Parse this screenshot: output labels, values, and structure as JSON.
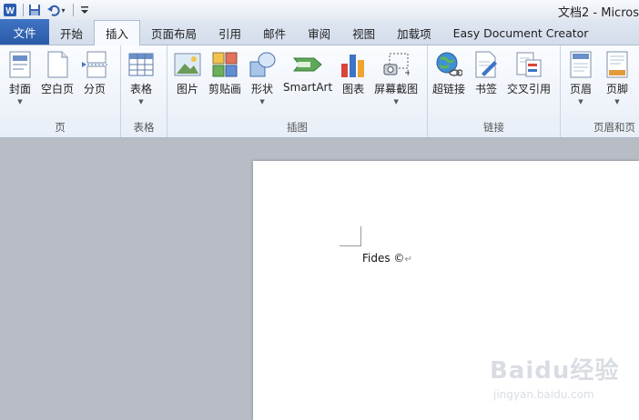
{
  "window": {
    "title": "文档2 - Micros"
  },
  "qat": {
    "undo_label": "↶",
    "more_label": "▾"
  },
  "tabs": [
    {
      "label": "文件"
    },
    {
      "label": "开始"
    },
    {
      "label": "插入"
    },
    {
      "label": "页面布局"
    },
    {
      "label": "引用"
    },
    {
      "label": "邮件"
    },
    {
      "label": "审阅"
    },
    {
      "label": "视图"
    },
    {
      "label": "加载项"
    },
    {
      "label": "Easy Document Creator"
    }
  ],
  "ribbon": {
    "groups": [
      {
        "label": "页",
        "buttons": [
          {
            "label": "封面",
            "icon": "cover-page-icon",
            "has_dropdown": true
          },
          {
            "label": "空白页",
            "icon": "blank-page-icon",
            "has_dropdown": false
          },
          {
            "label": "分页",
            "icon": "page-break-icon",
            "has_dropdown": false
          }
        ]
      },
      {
        "label": "表格",
        "buttons": [
          {
            "label": "表格",
            "icon": "table-icon",
            "has_dropdown": true
          }
        ]
      },
      {
        "label": "插图",
        "buttons": [
          {
            "label": "图片",
            "icon": "picture-icon",
            "has_dropdown": false
          },
          {
            "label": "剪贴画",
            "icon": "clip-art-icon",
            "has_dropdown": false
          },
          {
            "label": "形状",
            "icon": "shapes-icon",
            "has_dropdown": true
          },
          {
            "label": "SmartArt",
            "icon": "smartart-icon",
            "has_dropdown": false
          },
          {
            "label": "图表",
            "icon": "chart-icon",
            "has_dropdown": false
          },
          {
            "label": "屏幕截图",
            "icon": "screenshot-icon",
            "has_dropdown": true
          }
        ]
      },
      {
        "label": "链接",
        "buttons": [
          {
            "label": "超链接",
            "icon": "hyperlink-icon",
            "has_dropdown": false
          },
          {
            "label": "书签",
            "icon": "bookmark-icon",
            "has_dropdown": false
          },
          {
            "label": "交叉引用",
            "icon": "cross-reference-icon",
            "has_dropdown": false
          }
        ]
      },
      {
        "label": "页眉和页",
        "buttons": [
          {
            "label": "页眉",
            "icon": "header-icon",
            "has_dropdown": true
          },
          {
            "label": "页脚",
            "icon": "footer-icon",
            "has_dropdown": true
          }
        ]
      }
    ]
  },
  "document": {
    "text": "Fides ©",
    "para_mark": "↵"
  },
  "watermark": {
    "brand": "Baidu经验",
    "site": "jingyan.baidu.com"
  },
  "colors": {
    "file_tab": "#2a5aa8",
    "ribbon_bg": "#eef3fa",
    "doc_bg": "#b8bdc5"
  }
}
